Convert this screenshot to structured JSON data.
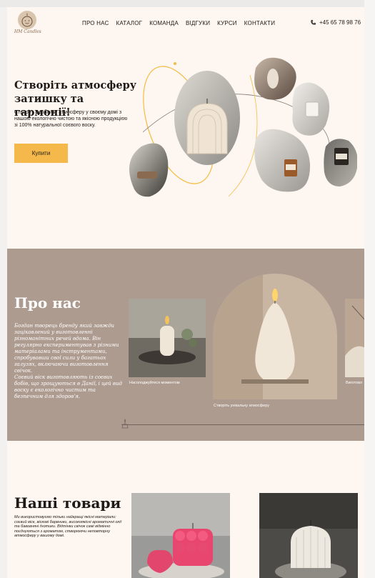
{
  "header": {
    "logo_text": "HM Candles",
    "nav": [
      "ПРО НАС",
      "КАТАЛОГ",
      "КОМАНДА",
      "ВІДГУКИ",
      "КУРСИ",
      "КОНТАКТИ"
    ],
    "phone": "+45 65 78 98 76"
  },
  "hero": {
    "title": "Створіть атмосферу затишку та гармонії!",
    "text": "Створіть особливу атмосферу у своєму домі з нашою екологічно чистою та якісною продукцією зі 100% натуральної соєвого воску.",
    "button": "Купити"
  },
  "about": {
    "title": "Про нас",
    "paragraph1": "Богдан творець бренду який завжди зацікавлений у виготовленні різноманітних речей вдома. Він регулярно експериментував з різними матеріалами та інструментами, спробувавши свої сили у багатьох галузях, включаючи виготовлення свічок.",
    "paragraph2": "Соєвий віск виготовляють із соєвих бобів, що зрощуються в Данії, і цей вид воску є екологічно чистим та безпечним для здоров'я.",
    "captions": [
      "Насолоджуйтеся моментом",
      "Створіть унікальну атмосферу",
      "Виготовл"
    ]
  },
  "products": {
    "title": "Наші товари",
    "text": "Ми використовуємо тільки найкращі якісні матеріали: соєвий віск, віскові барвники, високоякісні ароматичні олії та бавовняні ґнотики. Відтінки свічок самі відмінно поєднуються з ароматом, створюючи неповторну атмосферу у вашому домі."
  },
  "colors": {
    "accent": "#f5b94b",
    "background": "#fdf6f1",
    "about_bg": "#ae9b90"
  }
}
